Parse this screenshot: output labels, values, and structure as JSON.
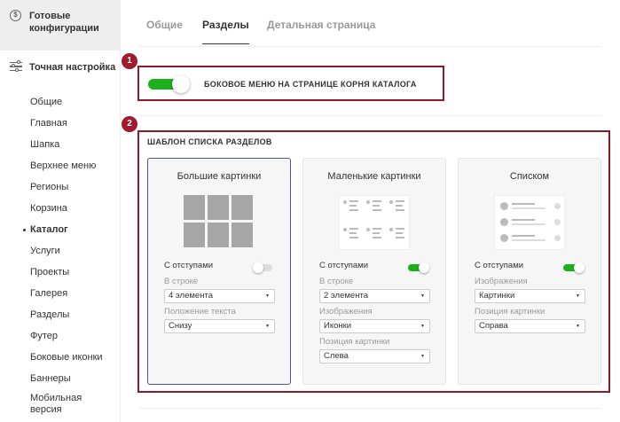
{
  "sidebar": {
    "top_label": "Готовые конфигурации",
    "section_label": "Точная настройка",
    "items": [
      {
        "label": "Общие"
      },
      {
        "label": "Главная"
      },
      {
        "label": "Шапка"
      },
      {
        "label": "Верхнее меню"
      },
      {
        "label": "Регионы"
      },
      {
        "label": "Корзина"
      },
      {
        "label": "Каталог",
        "active": true
      },
      {
        "label": "Услуги"
      },
      {
        "label": "Проекты"
      },
      {
        "label": "Галерея"
      },
      {
        "label": "Разделы"
      },
      {
        "label": "Футер"
      },
      {
        "label": "Боковые иконки"
      },
      {
        "label": "Баннеры"
      },
      {
        "label": "Мобильная версия"
      }
    ]
  },
  "tabs": [
    {
      "label": "Общие"
    },
    {
      "label": "Разделы",
      "active": true
    },
    {
      "label": "Детальная страница"
    }
  ],
  "badges": {
    "one": "1",
    "two": "2"
  },
  "section1": {
    "label": "БОКОВОЕ МЕНЮ НА СТРАНИЦЕ КОРНЯ КАТАЛОГА",
    "enabled": true
  },
  "section2": {
    "title": "ШАБЛОН СПИСКА РАЗДЕЛОВ",
    "cards": [
      {
        "title": "Большие картинки",
        "selected": true,
        "option_label": "С отступами",
        "option_on": false,
        "field1_label": "В строке",
        "field1_value": "4 элемента",
        "field2_label": "Положение текста",
        "field2_value": "Снизу"
      },
      {
        "title": "Маленькие картинки",
        "selected": false,
        "option_label": "С отступами",
        "option_on": true,
        "field1_label": "В строке",
        "field1_value": "2 элемента",
        "field2_label": "Изображения",
        "field2_value": "Иконки",
        "field3_label": "Позиция картинки",
        "field3_value": "Слева"
      },
      {
        "title": "Списком",
        "selected": false,
        "option_label": "С отступами",
        "option_on": true,
        "field1_label": "Изображения",
        "field1_value": "Картинки",
        "field2_label": "Позиция картинки",
        "field2_value": "Справа"
      }
    ]
  },
  "colors": {
    "accent_green": "#1db01d",
    "badge_red": "#a3192e",
    "frame_red": "#8b1a2b",
    "selected_border": "#4a5590"
  }
}
